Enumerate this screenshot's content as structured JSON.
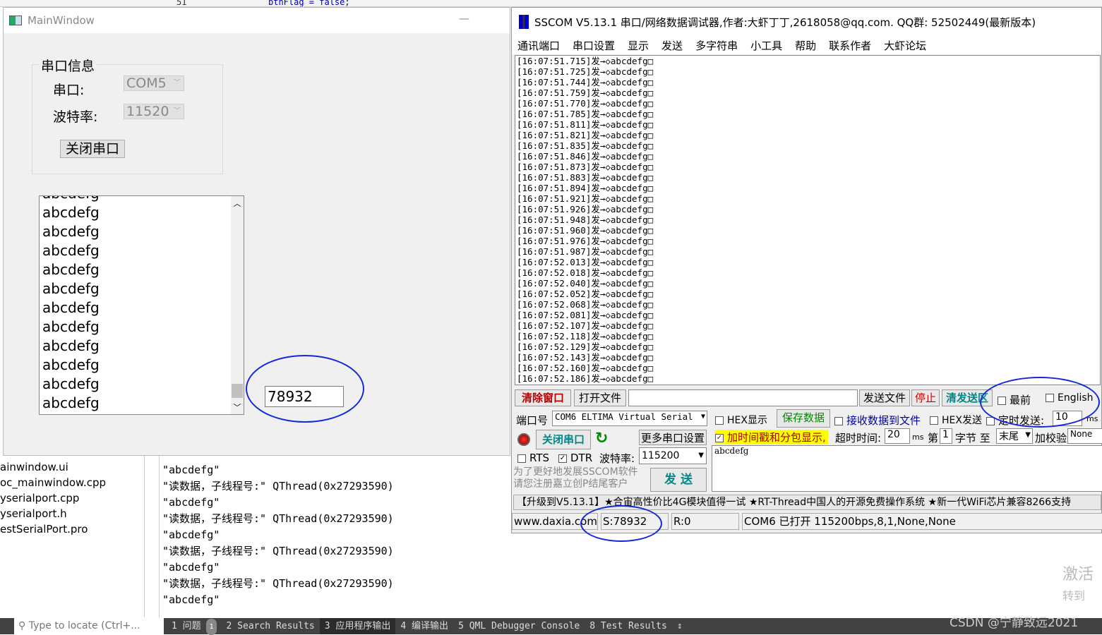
{
  "ide": {
    "top_snippet": "btnFlag = false;",
    "line_no": "51",
    "files": [
      "ainwindow.ui",
      "oc_mainwindow.cpp",
      "yserialport.cpp",
      "yserialport.h",
      "estSerialPort.pro"
    ],
    "output_lines": [
      "\"abcdefg\"",
      "\"读数据，子线程号:\" QThread(0x27293590)",
      "\"abcdefg\"",
      "\"读数据，子线程号:\" QThread(0x27293590)",
      "\"abcdefg\"",
      "\"读数据，子线程号:\" QThread(0x27293590)",
      "\"abcdefg\"",
      "\"读数据，子线程号:\" QThread(0x27293590)",
      "\"abcdefg\""
    ],
    "taskbar": {
      "locate_placeholder": "Type to locate (Ctrl+...",
      "tabs": [
        "1 问题",
        "2 Search Results",
        "3 应用程序输出",
        "4 编译输出",
        "5 QML Debugger Console",
        "8 Test Results"
      ],
      "problems_badge": "1",
      "active_tab": 2
    }
  },
  "mainwindow": {
    "title": "MainWindow",
    "group_title": "串口信息",
    "port_label": "串口:",
    "port_value": "COM5",
    "baud_label": "波特率:",
    "baud_value": "11520",
    "close_button": "关闭串口",
    "list_items": [
      "abcdefg",
      "abcdefg",
      "abcdefg",
      "abcdefg",
      "abcdefg",
      "abcdefg",
      "abcdefg",
      "abcdefg",
      "abcdefg",
      "abcdefg",
      "abcdefg",
      "abcdefg"
    ],
    "count_value": "78932"
  },
  "sscom": {
    "title": "SSCOM V5.13.1 串口/网络数据调试器,作者:大虾丁丁,2618058@qq.com. QQ群:  52502449(最新版本)",
    "menu": [
      "通讯端口",
      "串口设置",
      "显示",
      "发送",
      "多字符串",
      "小工具",
      "帮助",
      "联系作者",
      "大虾论坛"
    ],
    "log_suffix": "]发→◇abcdefg□",
    "log_times": [
      "16:07:51.715",
      "16:07:51.725",
      "16:07:51.744",
      "16:07:51.759",
      "16:07:51.770",
      "16:07:51.785",
      "16:07:51.811",
      "16:07:51.821",
      "16:07:51.835",
      "16:07:51.846",
      "16:07:51.873",
      "16:07:51.883",
      "16:07:51.894",
      "16:07:51.921",
      "16:07:51.926",
      "16:07:51.948",
      "16:07:51.960",
      "16:07:51.976",
      "16:07:51.987",
      "16:07:52.013",
      "16:07:52.018",
      "16:07:52.040",
      "16:07:52.052",
      "16:07:52.068",
      "16:07:52.081",
      "16:07:52.107",
      "16:07:52.118",
      "16:07:52.129",
      "16:07:52.143",
      "16:07:52.160",
      "16:07:52.186"
    ],
    "clear_window": "清除窗口",
    "open_file": "打开文件",
    "send_file": "发送文件",
    "stop": "停止",
    "clear_send": "清发送区",
    "topmost": "最前",
    "english": "English",
    "port_no_label": "端口号",
    "port_no_value": "COM6 ELTIMA Virtual Serial",
    "hex_display": "HEX显示",
    "save_data": "保存数据",
    "recv_to_file": "接收数据到文件",
    "hex_send": "HEX发送",
    "timed_send": "定时发送:",
    "timed_value": "10",
    "timed_unit": "ms",
    "close_port": "关闭串口",
    "more_settings": "更多串口设置",
    "timestamp_label": "加时间戳和分包显示,",
    "timeout_label": "超时时间:",
    "timeout_value": "20",
    "timeout_unit": "ms",
    "byte_from_label": "第",
    "byte_from_value": "1",
    "byte_to_label": "字节 至",
    "byte_to_value": "末尾",
    "checksum_label": "加校验",
    "checksum_value": "None",
    "rts": "RTS",
    "dtr": "DTR",
    "baud_label": "波特率:",
    "baud_value": "115200",
    "send_text": "abcdefg",
    "promo1": "为了更好地发展SSCOM软件",
    "promo2": "请您注册嘉立创P结尾客户",
    "send_button": "发 送",
    "ad_text": "【升级到V5.13.1】★合宙高性价比4G模块值得一试 ★RT-Thread中国人的开源免费操作系统 ★新一代WiFi芯片兼容8266支持",
    "status_site": "www.daxia.com",
    "status_sent": "S:78932",
    "status_recv": "R:0",
    "status_port": "COM6 已打开  115200bps,8,1,None,None",
    "dtr_checked": true,
    "rts_checked": false,
    "timestamp_checked": true
  },
  "watermark": "CSDN @宁静致远2021",
  "activate": [
    "激活",
    "转到"
  ],
  "colors": {
    "annotation": "#1428d8",
    "highlight": "#ffff00"
  }
}
